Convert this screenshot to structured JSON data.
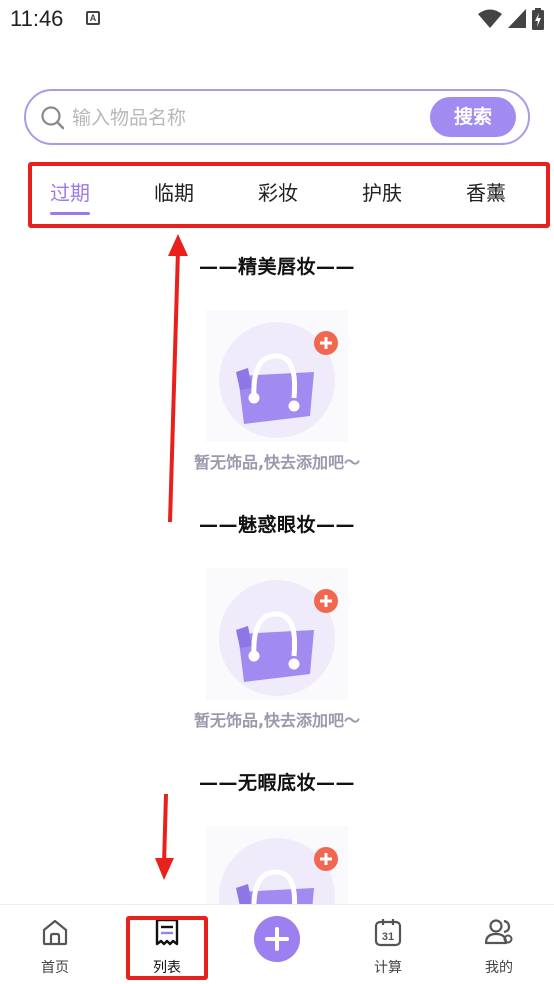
{
  "status_bar": {
    "time": "11:46",
    "notification_icon": "A"
  },
  "search": {
    "placeholder": "输入物品名称",
    "button_label": "搜索"
  },
  "tabs": [
    {
      "label": "过期",
      "active": true
    },
    {
      "label": "临期",
      "active": false
    },
    {
      "label": "彩妆",
      "active": false
    },
    {
      "label": "护肤",
      "active": false
    },
    {
      "label": "香薰",
      "active": false
    }
  ],
  "sections": [
    {
      "title": "——精美唇妆——",
      "empty_text": "暂无饰品,快去添加吧～"
    },
    {
      "title": "——魅惑眼妆——",
      "empty_text": "暂无饰品,快去添加吧～"
    },
    {
      "title": "——无暇底妆——",
      "empty_text": ""
    }
  ],
  "bottom_nav": [
    {
      "label": "首页",
      "icon": "home-icon"
    },
    {
      "label": "列表",
      "icon": "list-icon"
    },
    {
      "label": "",
      "icon": "plus-icon"
    },
    {
      "label": "计算",
      "icon": "calendar-31-icon"
    },
    {
      "label": "我的",
      "icon": "users-icon"
    }
  ],
  "calendar_icon_number": "31",
  "colors": {
    "accent": "#9d80f0",
    "annotation_red": "#e8211d",
    "search_border": "#a99be8"
  }
}
